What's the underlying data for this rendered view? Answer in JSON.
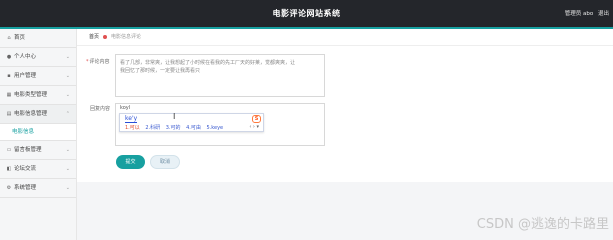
{
  "header": {
    "title": "电影评论网站系统",
    "role_text": "管理员 abo",
    "logout_text": "退出"
  },
  "breadcrumb": {
    "home": "首页",
    "current": "电影信息评论"
  },
  "sidebar": {
    "items": [
      {
        "label": "首页",
        "icon": "home-icon"
      },
      {
        "label": "个人中心",
        "icon": "user-icon"
      },
      {
        "label": "用户管理",
        "icon": "users-icon"
      },
      {
        "label": "电影类型管理",
        "icon": "grid-icon"
      },
      {
        "label": "电影信息管理",
        "icon": "film-icon"
      },
      {
        "label": "留言板管理",
        "icon": "message-icon"
      },
      {
        "label": "论坛交流",
        "icon": "forum-icon"
      },
      {
        "label": "系统管理",
        "icon": "settings-icon"
      }
    ],
    "sub_item": "电影信息"
  },
  "form": {
    "review_label": "评论内容",
    "review_text": "看了几部，非常爽，让我想起了小时候在看我的先工厂天的好莱，觉都爽爽，让我回忆了那时候，一定要让我再看只",
    "reply_label": "回复内容",
    "ime_typed": "koyl",
    "ime_pinyin": "ke'y",
    "ime_candidates": [
      "1.可以",
      "2.科研",
      "3.可的",
      "4.可由",
      "5.keye"
    ],
    "ime_nav": "‹ › ▾",
    "ime_logo": "S"
  },
  "buttons": {
    "submit": "提交",
    "cancel": "取消"
  },
  "watermark": "CSDN @逃逸的卡路里",
  "colors": {
    "topbar": "#24262b",
    "accent": "#17a0a0",
    "sidebar_bg": "#f5f6f7"
  }
}
